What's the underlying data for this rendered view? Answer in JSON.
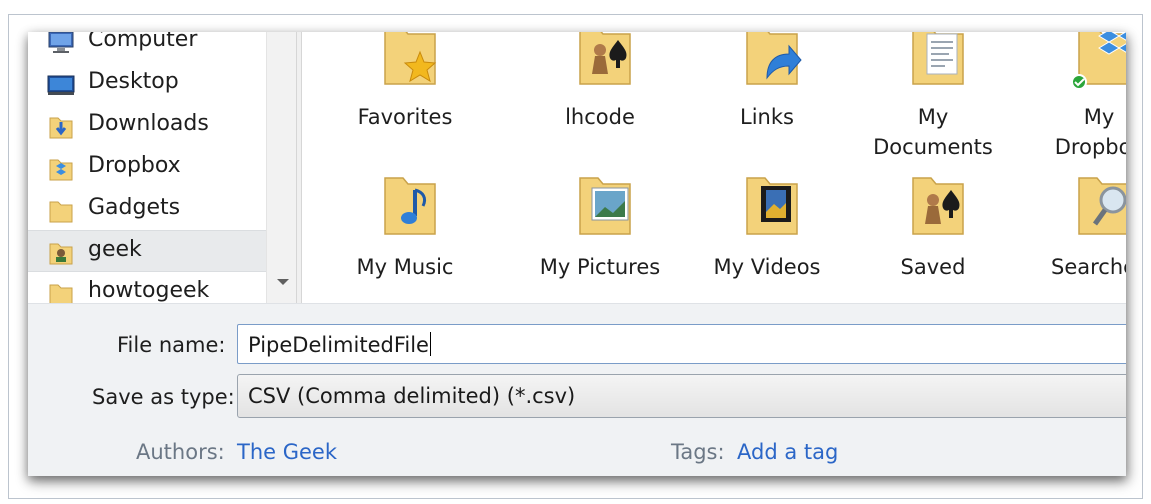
{
  "nav": {
    "items": [
      {
        "label": "Computer",
        "icon": "computer-icon"
      },
      {
        "label": "Desktop",
        "icon": "desktop-icon"
      },
      {
        "label": "Downloads",
        "icon": "downloads-folder-icon"
      },
      {
        "label": "Dropbox",
        "icon": "dropbox-folder-icon"
      },
      {
        "label": "Gadgets",
        "icon": "folder-icon"
      },
      {
        "label": "geek",
        "icon": "user-folder-icon"
      },
      {
        "label": "howtogeek",
        "icon": "folder-icon"
      }
    ],
    "selected": "geek"
  },
  "files": [
    {
      "label": "Favorites",
      "icon": "favorites-folder-icon"
    },
    {
      "label": "lhcode",
      "icon": "saved-games-folder-icon"
    },
    {
      "label": "Links",
      "icon": "links-folder-icon"
    },
    {
      "label": "My\nDocuments",
      "icon": "documents-folder-icon"
    },
    {
      "label": "My\nDropbox",
      "icon": "dropbox-folder-icon"
    },
    {
      "label": "My Music",
      "icon": "music-folder-icon"
    },
    {
      "label": "My Pictures",
      "icon": "pictures-folder-icon"
    },
    {
      "label": "My Videos",
      "icon": "videos-folder-icon"
    },
    {
      "label": "Saved",
      "icon": "saved-games-folder-icon"
    },
    {
      "label": "Searches",
      "icon": "searches-folder-icon"
    }
  ],
  "form": {
    "file_name_label": "File name:",
    "file_name_value": "PipeDelimitedFile",
    "save_type_label": "Save as type:",
    "save_type_value": "CSV (Comma delimited) (*.csv)"
  },
  "meta": {
    "authors_label": "Authors:",
    "authors_value": "The Geek",
    "tags_label": "Tags:",
    "tags_value": "Add a tag"
  },
  "colors": {
    "link": "#2b66c7",
    "folder": "#f3d27a",
    "selection": "#e8eaec"
  }
}
